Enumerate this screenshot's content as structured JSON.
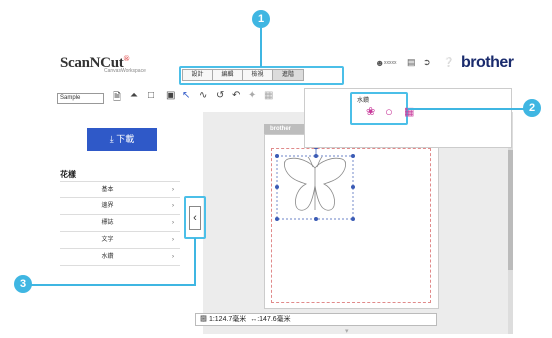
{
  "header": {
    "logo": "ScanNCut",
    "logo_reg": "®",
    "logo_sub": "CanvasWorkspace",
    "brand": "brother",
    "user_label": "xxxxx"
  },
  "tabs": [
    {
      "label": "設計",
      "active": false
    },
    {
      "label": "編輯",
      "active": false
    },
    {
      "label": "檢視",
      "active": false
    },
    {
      "label": "進階",
      "active": true
    }
  ],
  "toolbar": {
    "filename": "Sample"
  },
  "download": {
    "label": "下載"
  },
  "categories": {
    "title": "花樣",
    "items": [
      "基本",
      "邊界",
      "標誌",
      "文字",
      "水鑽"
    ]
  },
  "scan_panel": {
    "label": "水鑽"
  },
  "canvas": {
    "paper_brand": "brother"
  },
  "status": {
    "height": "1:124.7毫米",
    "width": "↔:147.6毫米"
  },
  "callouts": [
    "1",
    "2",
    "3"
  ],
  "colors": {
    "accent": "#3fb6e2",
    "download": "#2f59c8",
    "brand": "#1a2b6d",
    "selection": "#3b5bb5"
  }
}
